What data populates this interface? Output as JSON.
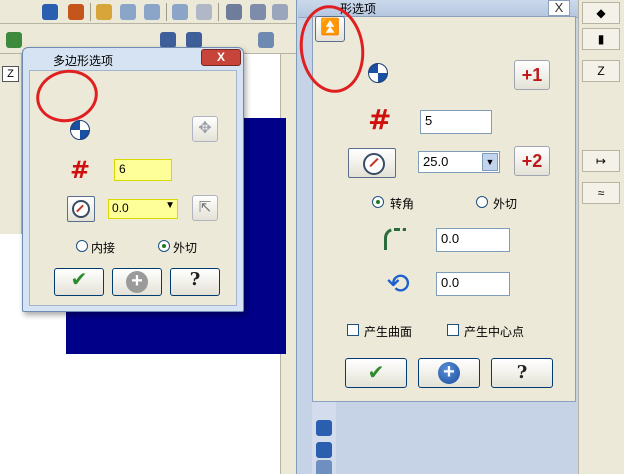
{
  "left_dialog": {
    "title": "多边形选项",
    "close_label": "X",
    "sides_value": "6",
    "angle_value": "0.0",
    "radio_inner_label": "内接",
    "radio_outer_label": "外切",
    "radio_outer_selected": true,
    "ok_icon": "green-check-icon",
    "add_icon": "plus-icon",
    "help_label": "?"
  },
  "right_dialog": {
    "title": "形选项",
    "close_label": "X",
    "sides_value": "5",
    "angle_value": "25.0",
    "increment_sides_label": "+1",
    "increment_angle_label": "+2",
    "radio_corner_label": "转角",
    "radio_tangent_label": "外切",
    "radio_corner_selected": true,
    "fillet_value": "0.0",
    "rotate_value": "0.0",
    "checkbox_surface_label": "产生曲面",
    "checkbox_center_label": "产生中心点",
    "help_label": "?"
  },
  "background": {
    "right_tool_label": "Z",
    "left_tool_label": "Z",
    "viewport_color": "#000088"
  },
  "colors": {
    "accent_red": "#d0100c",
    "annotation_red": "#e02020",
    "check_green": "#2e8b2e",
    "dialog_blue": "#c6d3e6"
  }
}
